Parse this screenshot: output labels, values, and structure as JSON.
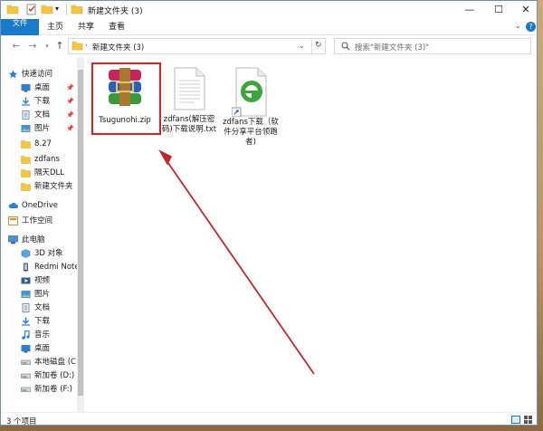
{
  "window": {
    "title": "新建文件夹 (3)"
  },
  "ribbon": {
    "tabs": [
      "文件",
      "主页",
      "共享",
      "查看"
    ]
  },
  "address": {
    "path": "新建文件夹 (3)"
  },
  "search": {
    "placeholder": "搜索\"新建文件夹 (3)\""
  },
  "sidebar": {
    "items": [
      {
        "label": "快速访问",
        "icon": "star-icon",
        "level": 0
      },
      {
        "label": "桌面",
        "icon": "desktop-icon",
        "level": 1,
        "pinned": true
      },
      {
        "label": "下载",
        "icon": "download-icon",
        "level": 1,
        "pinned": true
      },
      {
        "label": "文档",
        "icon": "document-icon",
        "level": 1,
        "pinned": true
      },
      {
        "label": "图片",
        "icon": "pictures-icon",
        "level": 1,
        "pinned": true
      },
      {
        "label": "8.27",
        "icon": "folder-icon",
        "level": 1
      },
      {
        "label": "zdfans",
        "icon": "folder-icon",
        "level": 1
      },
      {
        "label": "隔天DLL",
        "icon": "folder-icon",
        "level": 1
      },
      {
        "label": "新建文件夹",
        "icon": "folder-icon",
        "level": 1
      },
      {
        "label": "OneDrive",
        "icon": "cloud-icon",
        "level": 0
      },
      {
        "label": "工作空间",
        "icon": "workspace-icon",
        "level": 0
      },
      {
        "label": "此电脑",
        "icon": "computer-icon",
        "level": 0
      },
      {
        "label": "3D 对象",
        "icon": "3d-objects-icon",
        "level": 1
      },
      {
        "label": "Redmi Note",
        "icon": "phone-icon",
        "level": 1
      },
      {
        "label": "视频",
        "icon": "video-icon",
        "level": 1
      },
      {
        "label": "图片",
        "icon": "pictures-icon",
        "level": 1
      },
      {
        "label": "文档",
        "icon": "document-icon",
        "level": 1
      },
      {
        "label": "下载",
        "icon": "download-icon",
        "level": 1
      },
      {
        "label": "音乐",
        "icon": "music-icon",
        "level": 1
      },
      {
        "label": "桌面",
        "icon": "desktop-icon",
        "level": 1
      },
      {
        "label": "本地磁盘 (C:",
        "icon": "drive-icon",
        "level": 1
      },
      {
        "label": "新加卷 (D:)",
        "icon": "drive-icon",
        "level": 1
      },
      {
        "label": "新加卷 (F:)",
        "icon": "drive-icon",
        "level": 1
      }
    ]
  },
  "files": [
    {
      "name": "Tsugunohi.zip",
      "icon": "winrar-archive-icon",
      "selected": true
    },
    {
      "name": "zdfans(解压密码)下载说明.txt",
      "name_lines": [
        "zdfans(解压密",
        "码)下载说明.txt"
      ],
      "icon": "text-file-icon"
    },
    {
      "name": "zdfans下载（软件分享平台领跑者）",
      "name_lines": [
        "zdfans下载（软",
        "件分享平台领跑",
        "者)"
      ],
      "icon": "ie-shortcut-icon"
    }
  ],
  "status": {
    "item_count": "3 个项目"
  },
  "colors": {
    "accent": "#1979ca",
    "highlight": "#e02020",
    "arrow": "#c0282d",
    "selection": "#cce8ff"
  }
}
